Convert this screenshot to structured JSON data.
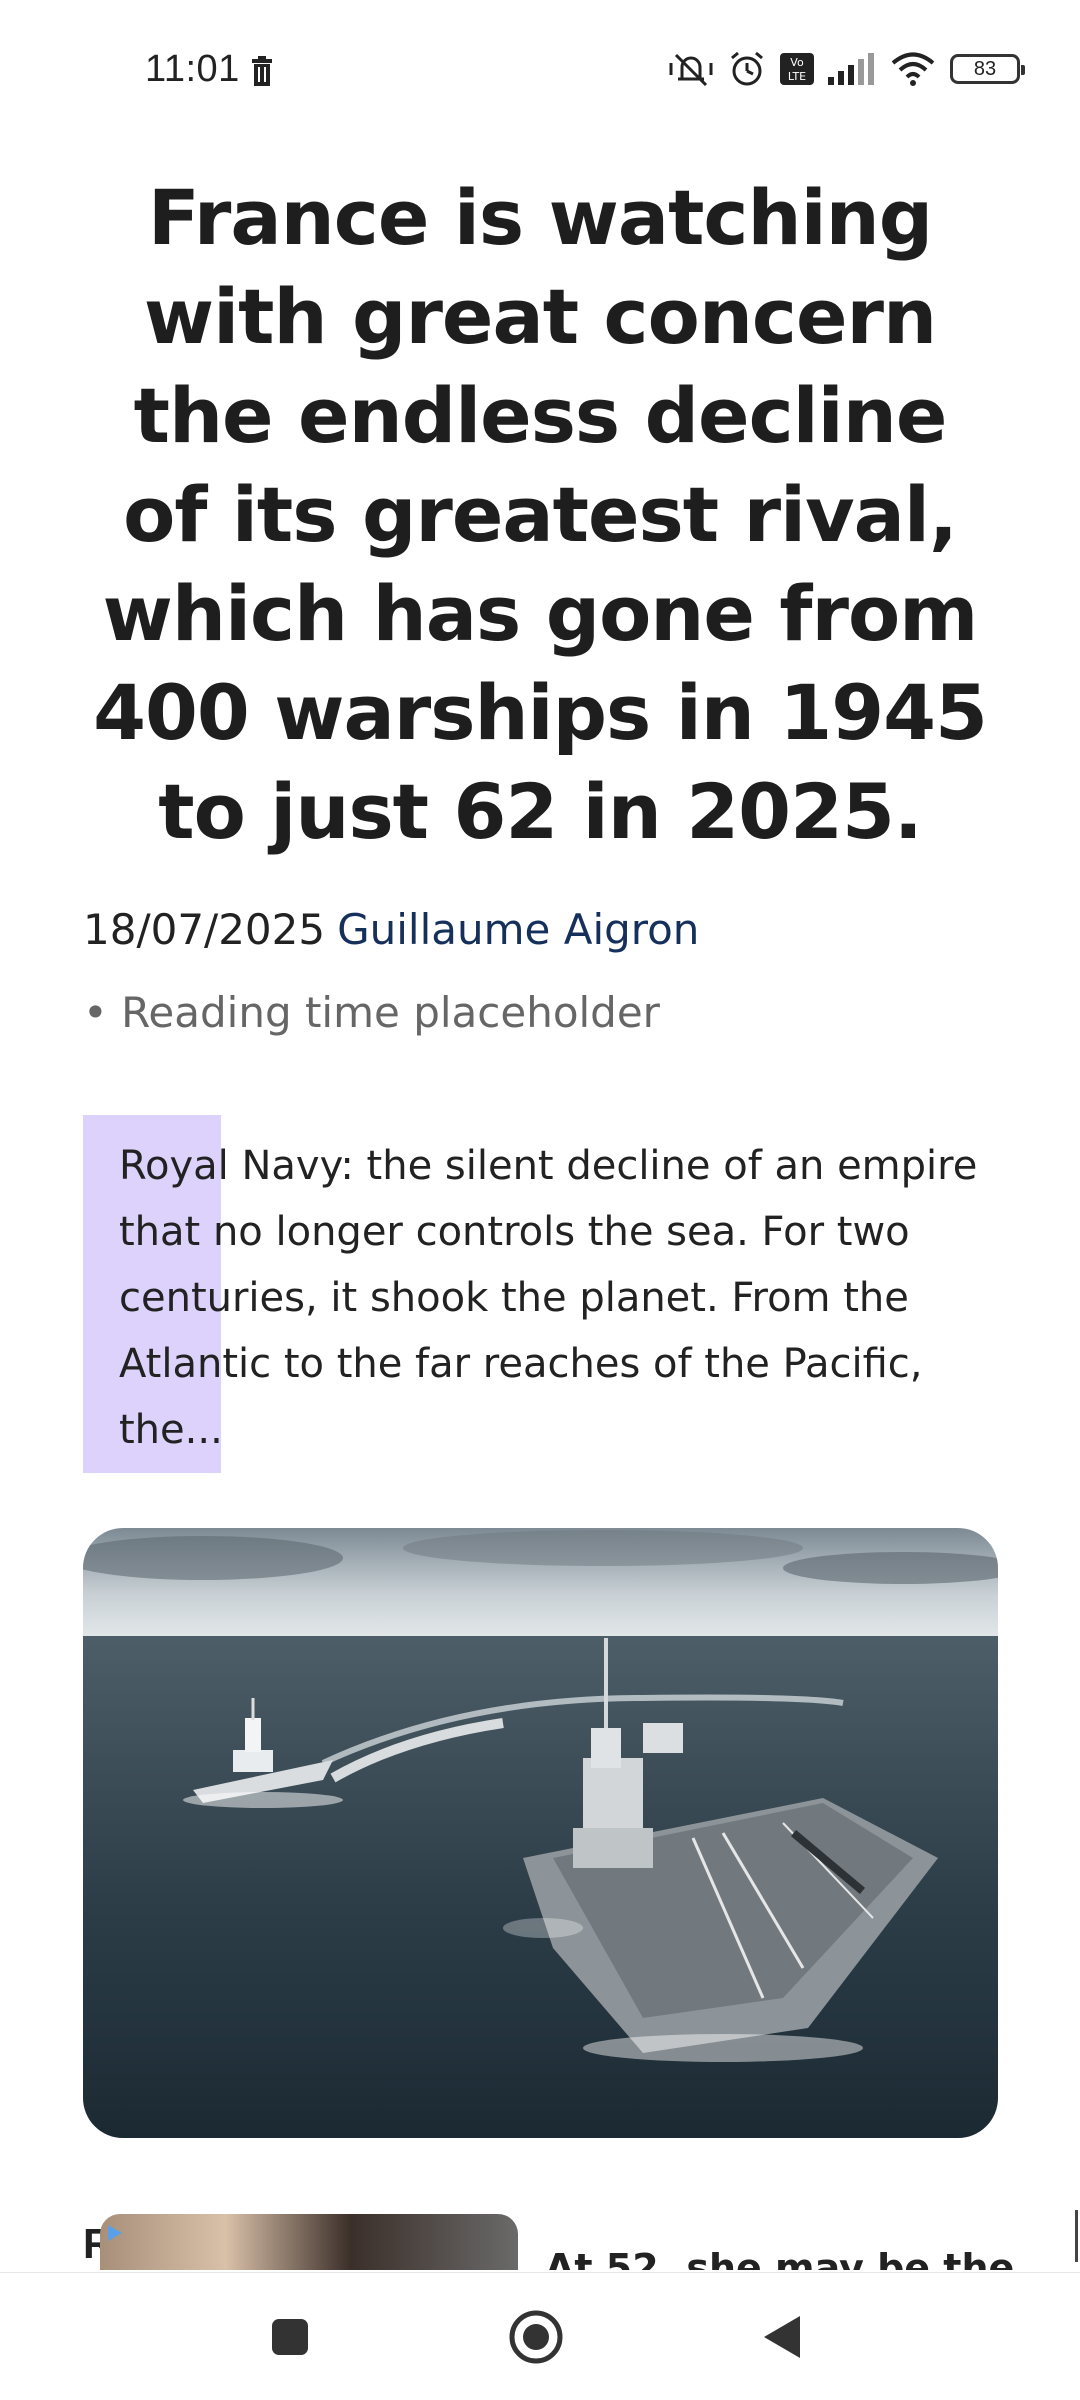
{
  "status_bar": {
    "time": "11:01",
    "battery": "83",
    "icons": [
      "trash-icon",
      "mute-vibrate-icon",
      "alarm-icon",
      "volte-icon",
      "signal-icon",
      "wifi-icon",
      "battery-icon"
    ]
  },
  "article": {
    "headline_lines": [
      "France is watching",
      "with great concern",
      "the endless decline",
      "of its greatest rival,",
      "which has gone from",
      "400 warships in 1945",
      "to just 62 in 2025."
    ],
    "date": "18/07/2025",
    "author": "Guillaume Aigron",
    "reading_time": "• Reading time placeholder",
    "excerpt": "Royal Navy: the silent decline of an empire that no longer controls the sea. For two centuries, it shook the planet. From the Atlantic to the far reaches of the Pacific, the...",
    "highlight_color": "#ddd2fb"
  },
  "related": {
    "letter": "R",
    "title": "At 52, she may be the"
  },
  "nav": {
    "icons": [
      "recent-apps-icon",
      "home-icon",
      "back-icon"
    ]
  }
}
